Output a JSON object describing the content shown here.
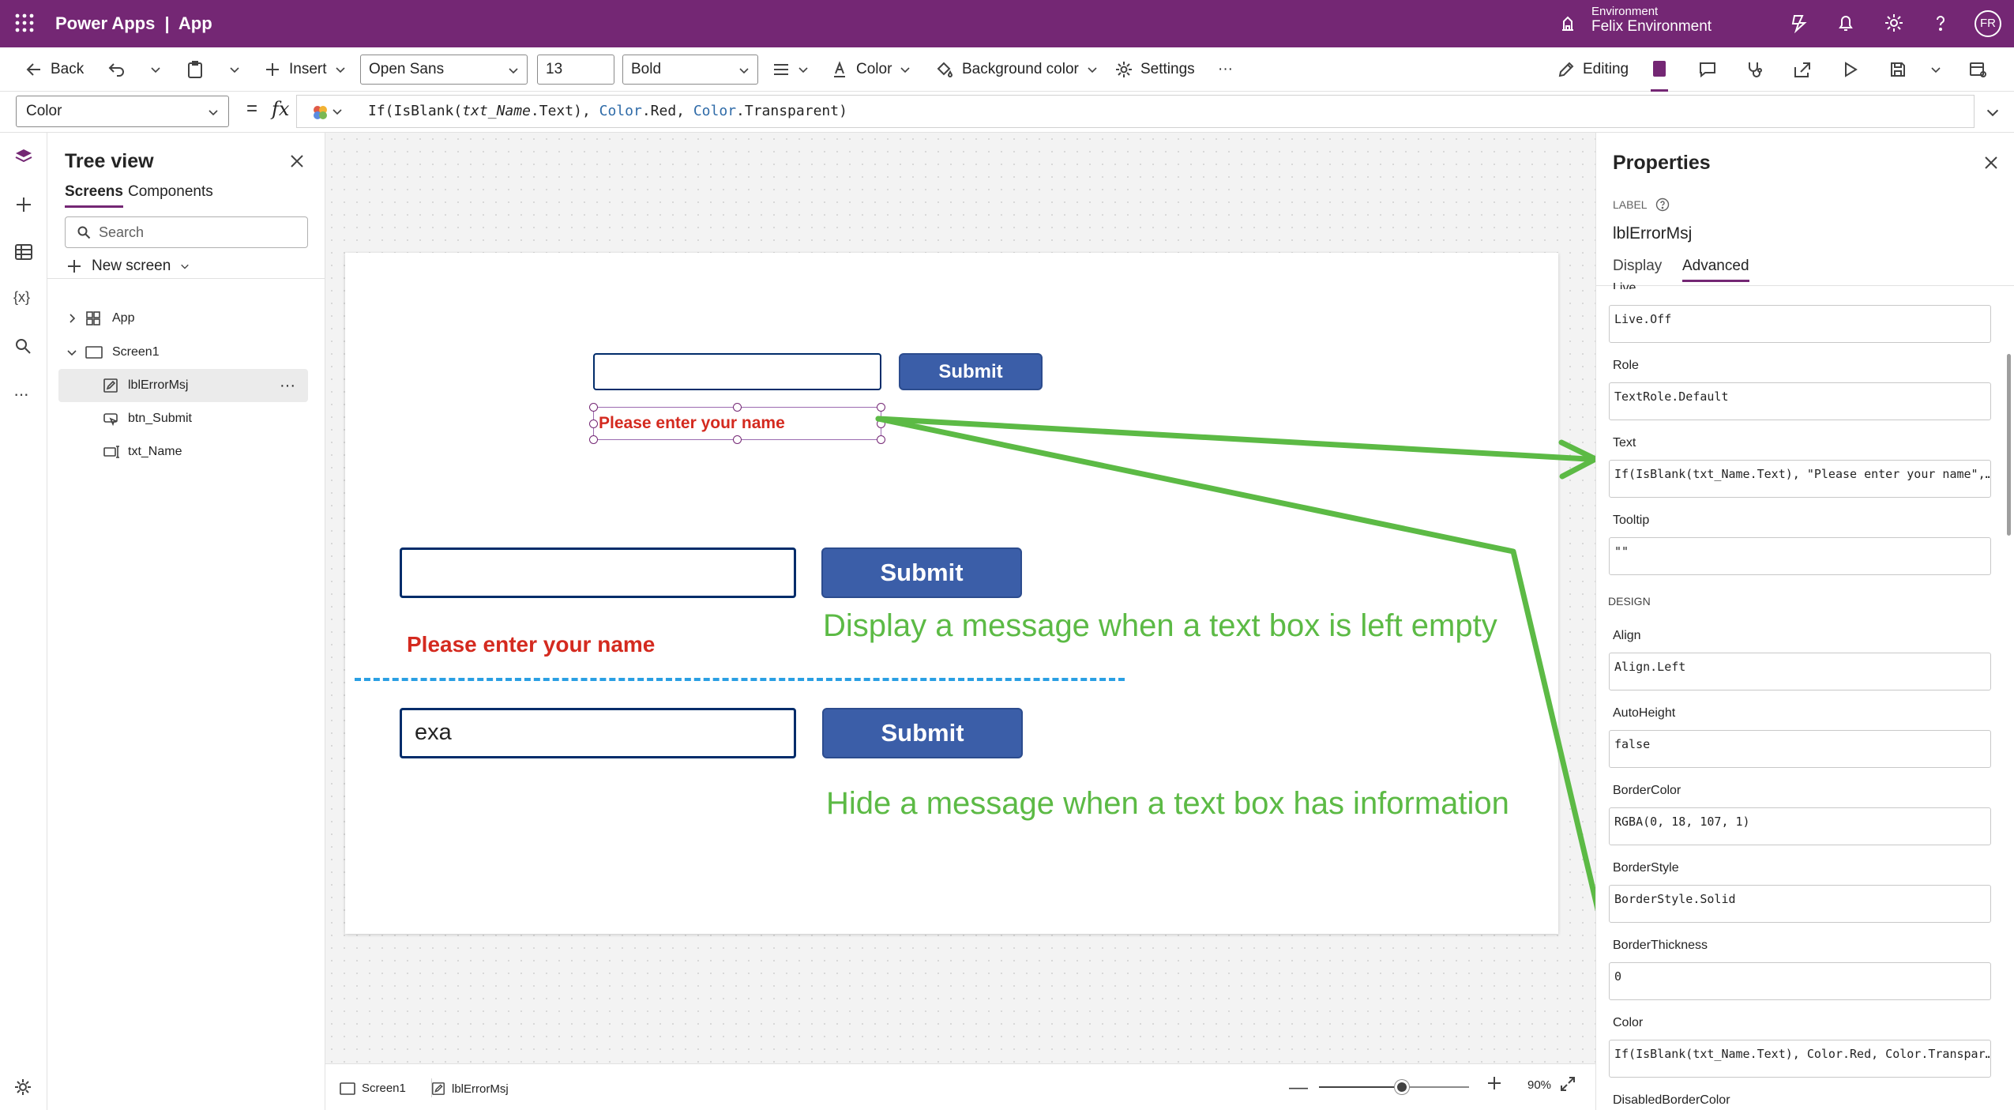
{
  "topbar": {
    "app_name": "Power Apps",
    "separator": "|",
    "app_label": "App",
    "environment_label": "Environment",
    "environment_name": "Felix Environment",
    "avatar_initials": "FR",
    "bg_color": "#742774"
  },
  "toolbar": {
    "back": "Back",
    "insert": "Insert",
    "font": "Open Sans",
    "font_size": "13",
    "font_weight": "Bold",
    "color": "Color",
    "background_color": "Background color",
    "settings": "Settings",
    "more": "···",
    "editing": "Editing"
  },
  "formula": {
    "property": "Color",
    "equals": "=",
    "fx": "fx",
    "parts": [
      "If(IsBlank(",
      "txt_Name",
      ".Text), ",
      "Color",
      ".Red, ",
      "Color",
      ".Transparent)"
    ]
  },
  "tree": {
    "title": "Tree view",
    "tabs": [
      "Screens",
      "Components"
    ],
    "search_placeholder": "Search",
    "new_screen": "New screen",
    "items": [
      "App",
      "Screen1",
      "lblErrorMsj",
      "btn_Submit",
      "txt_Name"
    ],
    "item_more": "···"
  },
  "canvas": {
    "small_submit": "Submit",
    "small_error": "Please enter your name",
    "submit_1": "Submit",
    "error_1": "Please enter your name",
    "annotation_1": "Display a message when a text box is left empty",
    "input_2_value": "exa",
    "submit_2": "Submit",
    "annotation_2": "Hide a message when a text box has information",
    "annotation_color": "#5cba45",
    "error_color": "#d42a1f",
    "button_color": "#3b5ea8"
  },
  "statusbar": {
    "screen": "Screen1",
    "selected": "lblErrorMsj",
    "zoom": "90%",
    "zoom_level": 0.55
  },
  "properties": {
    "title": "Properties",
    "control_type": "LABEL",
    "control_name": "lblErrorMsj",
    "tabs": [
      "Display",
      "Advanced"
    ],
    "partial_label": "Live",
    "design_header": "DESIGN",
    "fields": [
      {
        "label": "",
        "value": "Live.Off"
      },
      {
        "label": "Role",
        "value": "TextRole.Default"
      },
      {
        "label": "Text",
        "value": "If(IsBlank(txt_Name.Text), \"Please enter your name\",…"
      },
      {
        "label": "Tooltip",
        "value": "\"\""
      },
      {
        "label": "Align",
        "value": "Align.Left"
      },
      {
        "label": "AutoHeight",
        "value": "false"
      },
      {
        "label": "BorderColor",
        "value": "RGBA(0, 18, 107, 1)"
      },
      {
        "label": "BorderStyle",
        "value": "BorderStyle.Solid"
      },
      {
        "label": "BorderThickness",
        "value": "0"
      },
      {
        "label": "Color",
        "value": "If(IsBlank(txt_Name.Text), Color.Red, Color.Transpar…"
      },
      {
        "label": "DisabledBorderColor",
        "value": ""
      }
    ]
  }
}
